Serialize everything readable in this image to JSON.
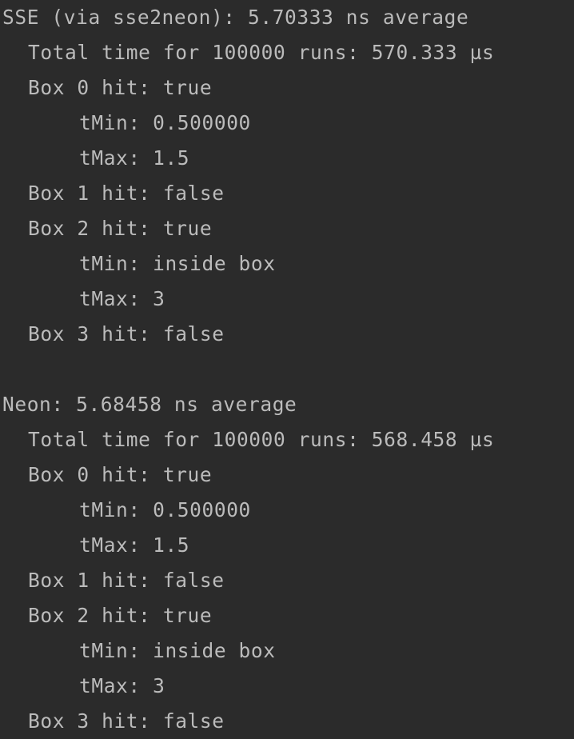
{
  "console": {
    "blocks": [
      {
        "header": "SSE (via sse2neon): 5.70333 ns average",
        "total": "Total time for 100000 runs: 570.333 µs",
        "boxes": [
          {
            "hit": "Box 0 hit: true",
            "tmin": "tMin: 0.500000",
            "tmax": "tMax: 1.5"
          },
          {
            "hit": "Box 1 hit: false"
          },
          {
            "hit": "Box 2 hit: true",
            "tmin": "tMin: inside box",
            "tmax": "tMax: 3"
          },
          {
            "hit": "Box 3 hit: false"
          }
        ]
      },
      {
        "header": "Neon: 5.68458 ns average",
        "total": "Total time for 100000 runs: 568.458 µs",
        "boxes": [
          {
            "hit": "Box 0 hit: true",
            "tmin": "tMin: 0.500000",
            "tmax": "tMax: 1.5"
          },
          {
            "hit": "Box 1 hit: false"
          },
          {
            "hit": "Box 2 hit: true",
            "tmin": "tMin: inside box",
            "tmax": "tMax: 3"
          },
          {
            "hit": "Box 3 hit: false"
          }
        ]
      }
    ]
  },
  "colors": {
    "background": "#2b2b2b",
    "text": "#bbbbbb"
  }
}
